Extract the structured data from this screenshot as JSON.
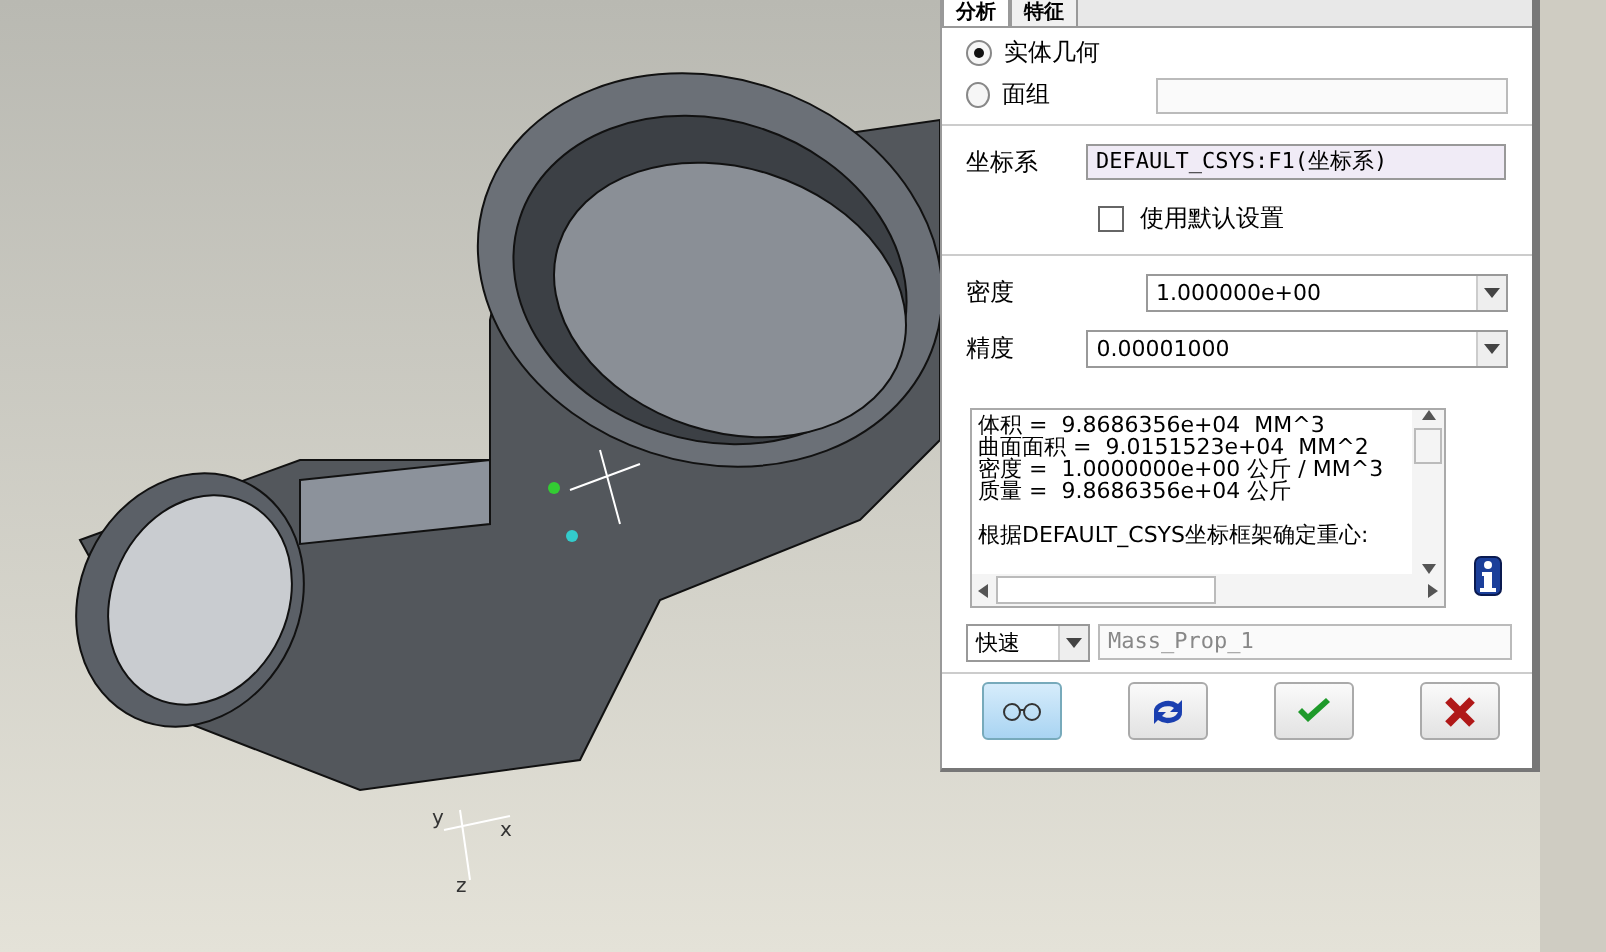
{
  "viewport": {
    "triad_labels": [
      {
        "kind": "y",
        "text": "y"
      },
      {
        "kind": "x",
        "text": "x"
      },
      {
        "kind": "z",
        "text": "z"
      }
    ]
  },
  "panel": {
    "tabs": [
      {
        "label": "分析",
        "selected": true
      },
      {
        "label": "特征",
        "selected": false
      }
    ],
    "geometry": [
      {
        "label": "实体几何",
        "selected": true
      },
      {
        "label": "面组",
        "selected": false
      }
    ],
    "csys": {
      "label": "坐标系",
      "value": "DEFAULT_CSYS:F1(坐标系)"
    },
    "use_default": {
      "label": "使用默认设置",
      "checked": false
    },
    "density": {
      "label": "密度",
      "value": "1.000000e+00"
    },
    "accuracy": {
      "label": "精度",
      "value": "0.00001000"
    },
    "results": [
      "体积 =  9.8686356e+04  MM^3",
      "曲面面积 =  9.0151523e+04  MM^2",
      "密度 =  1.0000000e+00 公斤 / MM^3",
      "质量 =  9.8686356e+04 公斤"
    ],
    "results_note": "根据DEFAULT_CSYS坐标框架确定重心:",
    "mode": "快速",
    "name": "Mass_Prop_1",
    "buttons": [
      {
        "kind": "preview",
        "selected": true
      },
      {
        "kind": "repeat",
        "selected": false
      },
      {
        "kind": "ok",
        "selected": false
      },
      {
        "kind": "cancel",
        "selected": false
      }
    ]
  }
}
